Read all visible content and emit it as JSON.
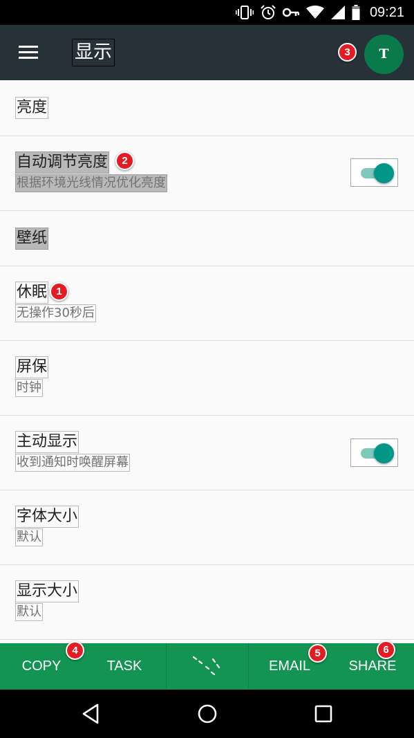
{
  "status_bar": {
    "time": "09:21",
    "icons": [
      "vibrate-icon",
      "alarm-icon",
      "vpn-key-icon",
      "wifi-icon",
      "cellular-signal-icon",
      "battery-icon"
    ]
  },
  "toolbar": {
    "title": "显示",
    "menu_icon": "hamburger-menu-icon",
    "avatar_letter": "T",
    "avatar_color": "#0b7a4a",
    "background": "#263238"
  },
  "settings": [
    {
      "title": "亮度"
    },
    {
      "title": "自动调节亮度",
      "subtitle": "根据环境光线情况优化亮度",
      "toggle": true,
      "highlighted": true
    },
    {
      "title": "壁纸",
      "highlighted": true
    },
    {
      "title": "休眠",
      "subtitle": "无操作30秒后"
    },
    {
      "title": "屏保",
      "subtitle": "时钟"
    },
    {
      "title": "主动显示",
      "subtitle": "收到通知时唤醒屏幕",
      "toggle": true
    },
    {
      "title": "字体大小",
      "subtitle": "默认"
    },
    {
      "title": "显示大小",
      "subtitle": "默认"
    }
  ],
  "badges": [
    "1",
    "2",
    "3",
    "4",
    "5",
    "6"
  ],
  "action_bar": {
    "copy": "COPY",
    "task": "TASK",
    "drag_icon": "drag-handle-icon",
    "email": "EMAIL",
    "share": "SHARE",
    "background": "#149452"
  },
  "nav_bar": {
    "icons": [
      "back-icon",
      "home-icon",
      "recents-icon"
    ]
  },
  "accent_color": "#009688",
  "badge_color": "#e31b23"
}
